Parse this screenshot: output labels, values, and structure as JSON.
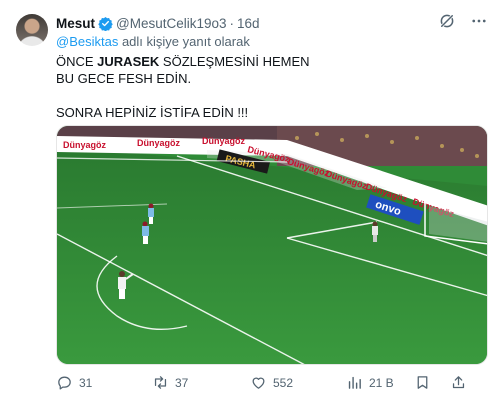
{
  "tweet": {
    "display_name": "Mesut",
    "handle": "@MesutCelik19o3",
    "dot": "·",
    "time": "16d",
    "reply_mention": "@Besiktas",
    "reply_suffix": " adlı kişiye yanıt olarak",
    "text_line1_prefix": "ÖNCE ",
    "text_line1_bold": "JURASEK",
    "text_line1_suffix": " SÖZLEŞMESİNİ HEMEN",
    "text_line2": "BU GECE FESH EDİN.",
    "text_line3": "SONRA HEPİNİZ İSTİFA EDİN !!!"
  },
  "media": {
    "board_texts": [
      "Dünyagöz",
      "Dünyagöz",
      "Dünyagöz",
      "Dünyagöz",
      "Dünyagöz",
      "Dünyagöz",
      "Dünyagöz",
      "Dünyagöz"
    ],
    "pasha_text": "PASHA",
    "onvo_text": "onvo"
  },
  "actions": {
    "replies": "31",
    "reposts": "37",
    "likes": "552",
    "views": "21 B"
  },
  "colors": {
    "accent": "#1d9bf0",
    "muted": "#536471",
    "pitch": "#2f8b37"
  }
}
